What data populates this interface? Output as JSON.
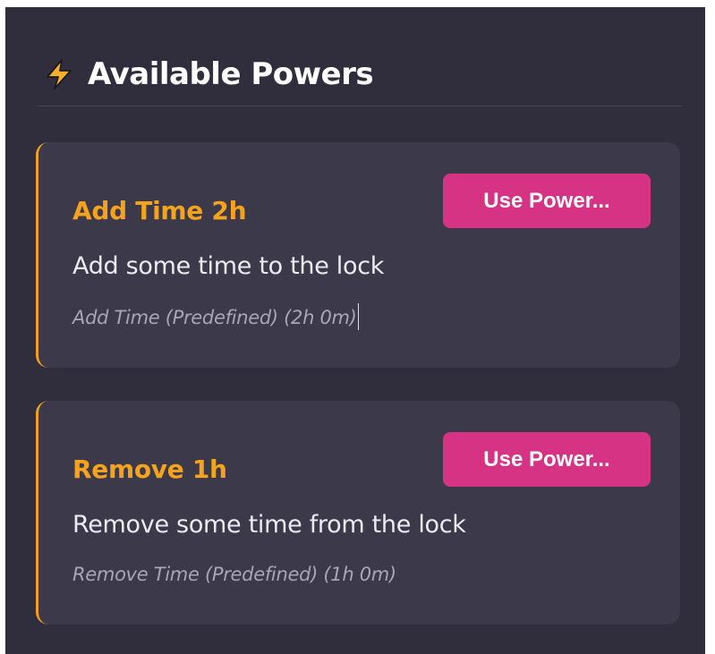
{
  "header": {
    "icon": "lightning-bolt-icon",
    "title": "Available Powers"
  },
  "colors": {
    "background": "#302d3c",
    "card": "#3c3a4a",
    "accent": "#f0a020",
    "button": "#d63384"
  },
  "powers": [
    {
      "title": "Add Time 2h",
      "description": "Add some time to the lock",
      "meta": "Add Time (Predefined) (2h 0m)",
      "button_label": "Use Power..."
    },
    {
      "title": "Remove 1h",
      "description": "Remove some time from the lock",
      "meta": "Remove Time (Predefined) (1h 0m)",
      "button_label": "Use Power..."
    }
  ]
}
